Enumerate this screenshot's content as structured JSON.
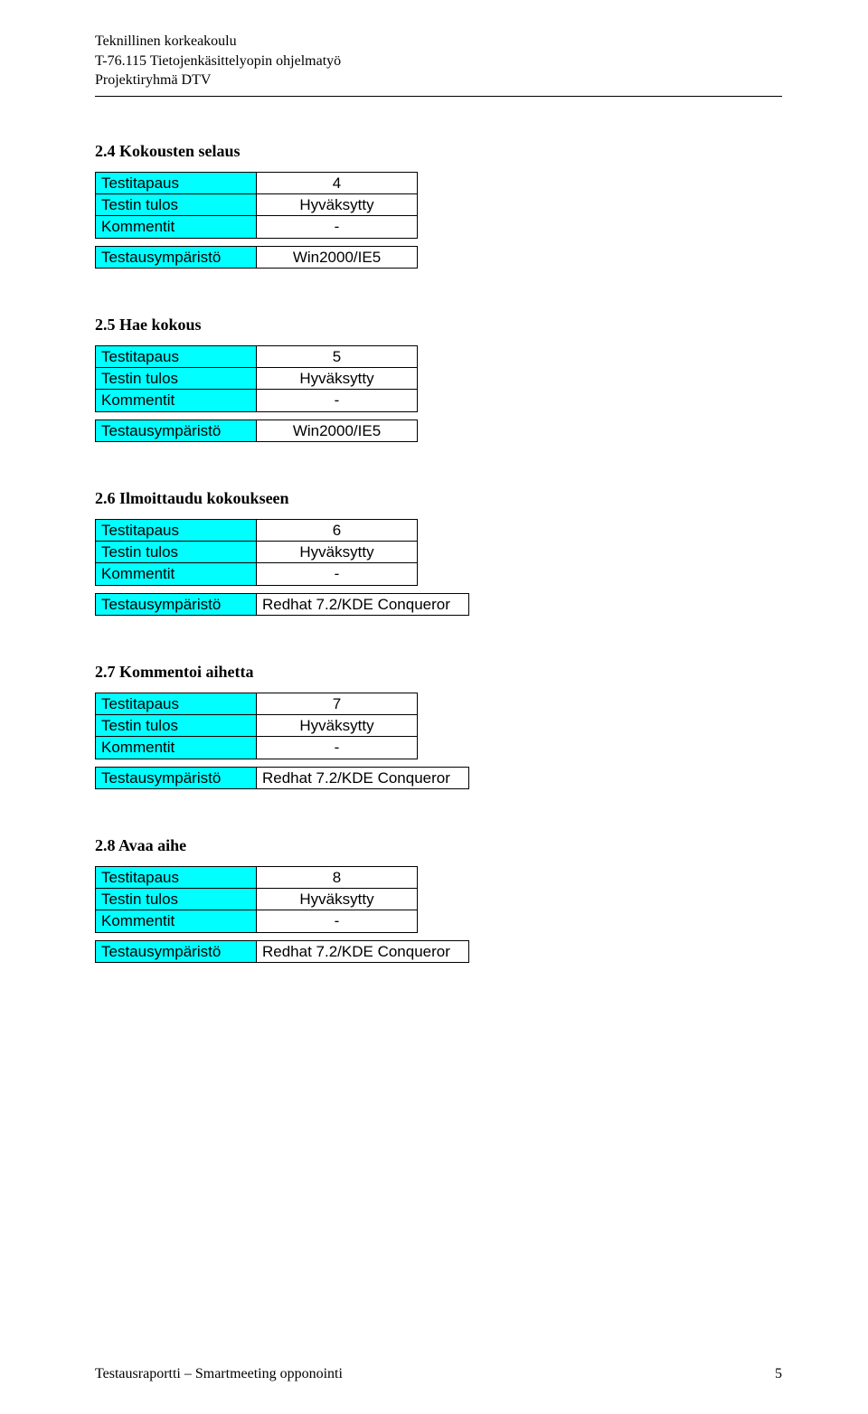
{
  "header": {
    "line1": "Teknillinen korkeakoulu",
    "line2": "T-76.115 Tietojenkäsittelyopin ohjelmatyö",
    "line3": "Projektiryhmä DTV"
  },
  "labels": {
    "testitapaus": "Testitapaus",
    "testin_tulos": "Testin tulos",
    "kommentit": "Kommentit",
    "testausymparisto": "Testausympäristö"
  },
  "sections": [
    {
      "title": "2.4 Kokousten selaus",
      "testitapaus": "4",
      "testin_tulos": "Hyväksytty",
      "kommentit": "-",
      "testausymparisto": "Win2000/IE5",
      "env_align": "center"
    },
    {
      "title": "2.5 Hae kokous",
      "testitapaus": "5",
      "testin_tulos": "Hyväksytty",
      "kommentit": "-",
      "testausymparisto": "Win2000/IE5",
      "env_align": "center"
    },
    {
      "title": "2.6 Ilmoittaudu kokoukseen",
      "testitapaus": "6",
      "testin_tulos": "Hyväksytty",
      "kommentit": "-",
      "testausymparisto": "Redhat 7.2/KDE Conqueror",
      "env_align": "left"
    },
    {
      "title": "2.7 Kommentoi aihetta",
      "testitapaus": "7",
      "testin_tulos": "Hyväksytty",
      "kommentit": "-",
      "testausymparisto": "Redhat 7.2/KDE Conqueror",
      "env_align": "left"
    },
    {
      "title": "2.8 Avaa aihe",
      "testitapaus": "8",
      "testin_tulos": "Hyväksytty",
      "kommentit": "-",
      "testausymparisto": "Redhat 7.2/KDE Conqueror",
      "env_align": "left"
    }
  ],
  "footer": {
    "text": "Testausraportti – Smartmeeting opponointi",
    "page": "5"
  }
}
